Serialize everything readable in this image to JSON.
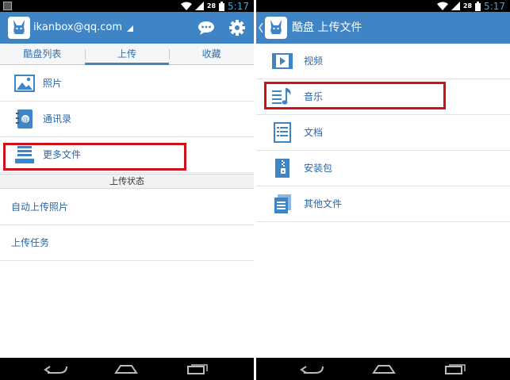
{
  "status_bar": {
    "signal_badge": "28",
    "time": "5:17"
  },
  "left": {
    "account": "ikanbox@qq.com",
    "tabs": [
      {
        "label": "酷盘列表"
      },
      {
        "label": "上传",
        "active": true
      },
      {
        "label": "收藏"
      }
    ],
    "items": [
      {
        "label": "照片",
        "icon": "photo-icon"
      },
      {
        "label": "通讯录",
        "icon": "contacts-icon"
      },
      {
        "label": "更多文件",
        "icon": "more-files-icon"
      }
    ],
    "section_header": "上传状态",
    "status_items": [
      {
        "label": "自动上传照片"
      },
      {
        "label": "上传任务"
      }
    ]
  },
  "right": {
    "title": "酷盘 上传文件",
    "items": [
      {
        "label": "视频",
        "icon": "video-icon"
      },
      {
        "label": "音乐",
        "icon": "music-icon"
      },
      {
        "label": "文档",
        "icon": "document-icon"
      },
      {
        "label": "安装包",
        "icon": "package-icon"
      },
      {
        "label": "其他文件",
        "icon": "other-files-icon"
      }
    ]
  },
  "colors": {
    "accent": "#3f85c5",
    "highlight": "#d0111a",
    "link": "#2a66a8"
  }
}
